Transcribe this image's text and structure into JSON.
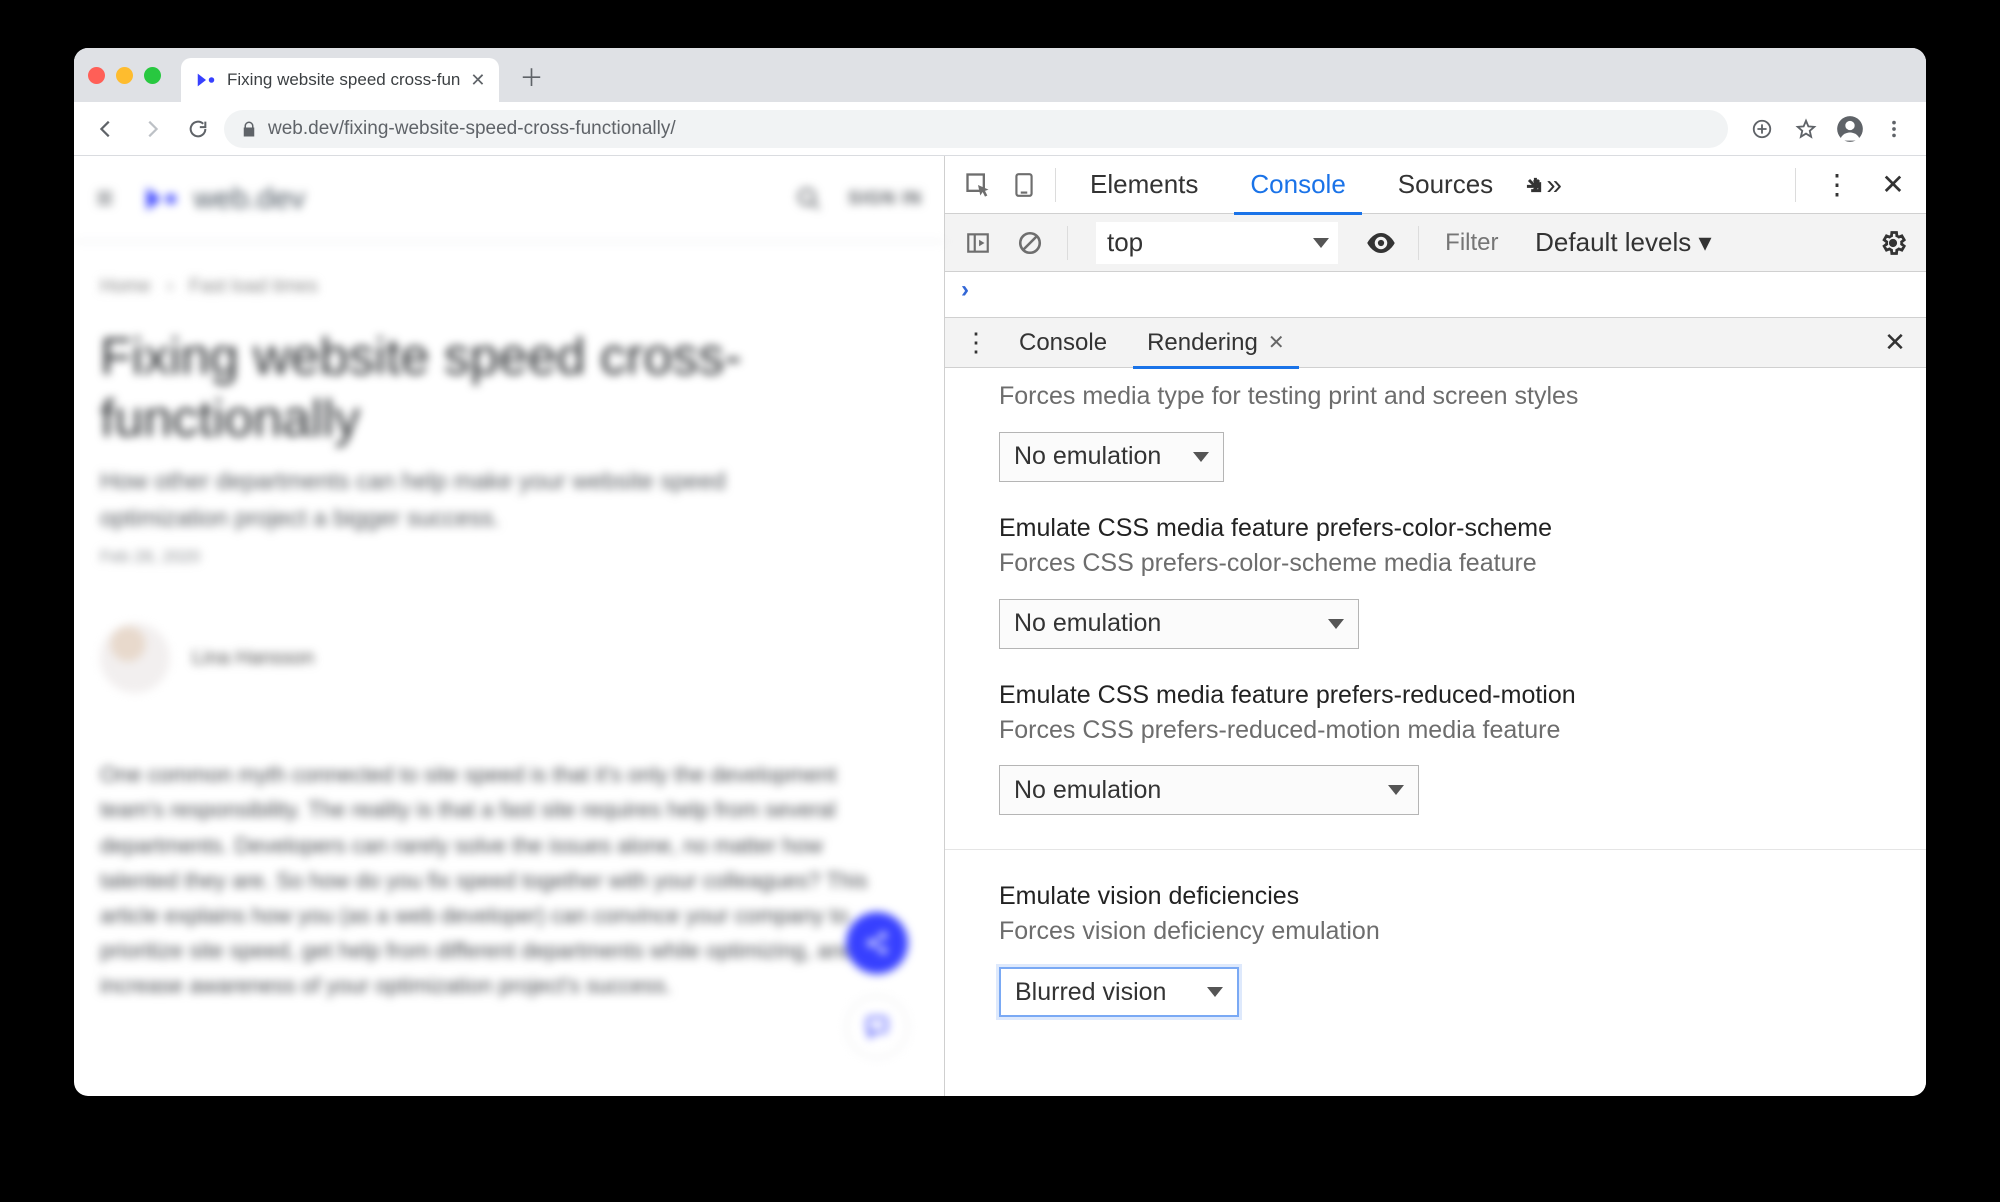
{
  "browser": {
    "tab_title": "Fixing website speed cross-fun",
    "url_display": "web.dev/fixing-website-speed-cross-functionally/",
    "url_host": "web.dev"
  },
  "page": {
    "site_name": "web.dev",
    "sign_in": "SIGN IN",
    "breadcrumb": {
      "home": "Home",
      "section": "Fast load times"
    },
    "title": "Fixing website speed cross-functionally",
    "subtitle": "How other departments can help make your website speed optimization project a bigger success.",
    "date": "Feb 28, 2020",
    "author": "Lina Hansson",
    "body": "One common myth connected to site speed is that it's only the development team's responsibility. The reality is that a fast site requires help from several departments. Developers can rarely solve the issues alone, no matter how talented they are. So how do you fix speed together with your colleagues? This article explains how you (as a web developer) can convince your company to prioritize site speed, get help from different departments while optimizing, and increase awareness of your optimization project's success."
  },
  "devtools": {
    "tabs": {
      "elements": "Elements",
      "console": "Console",
      "sources": "Sources"
    },
    "context": "top",
    "filter_placeholder": "Filter",
    "levels": "Default levels ▾",
    "drawer": {
      "tab_console": "Console",
      "tab_rendering": "Rendering",
      "media_type_desc": "Forces media type for testing print and screen styles",
      "media_type_value": "No emulation",
      "color_scheme_title": "Emulate CSS media feature prefers-color-scheme",
      "color_scheme_desc": "Forces CSS prefers-color-scheme media feature",
      "color_scheme_value": "No emulation",
      "reduced_motion_title": "Emulate CSS media feature prefers-reduced-motion",
      "reduced_motion_desc": "Forces CSS prefers-reduced-motion media feature",
      "reduced_motion_value": "No emulation",
      "vision_title": "Emulate vision deficiencies",
      "vision_desc": "Forces vision deficiency emulation",
      "vision_value": "Blurred vision"
    }
  }
}
